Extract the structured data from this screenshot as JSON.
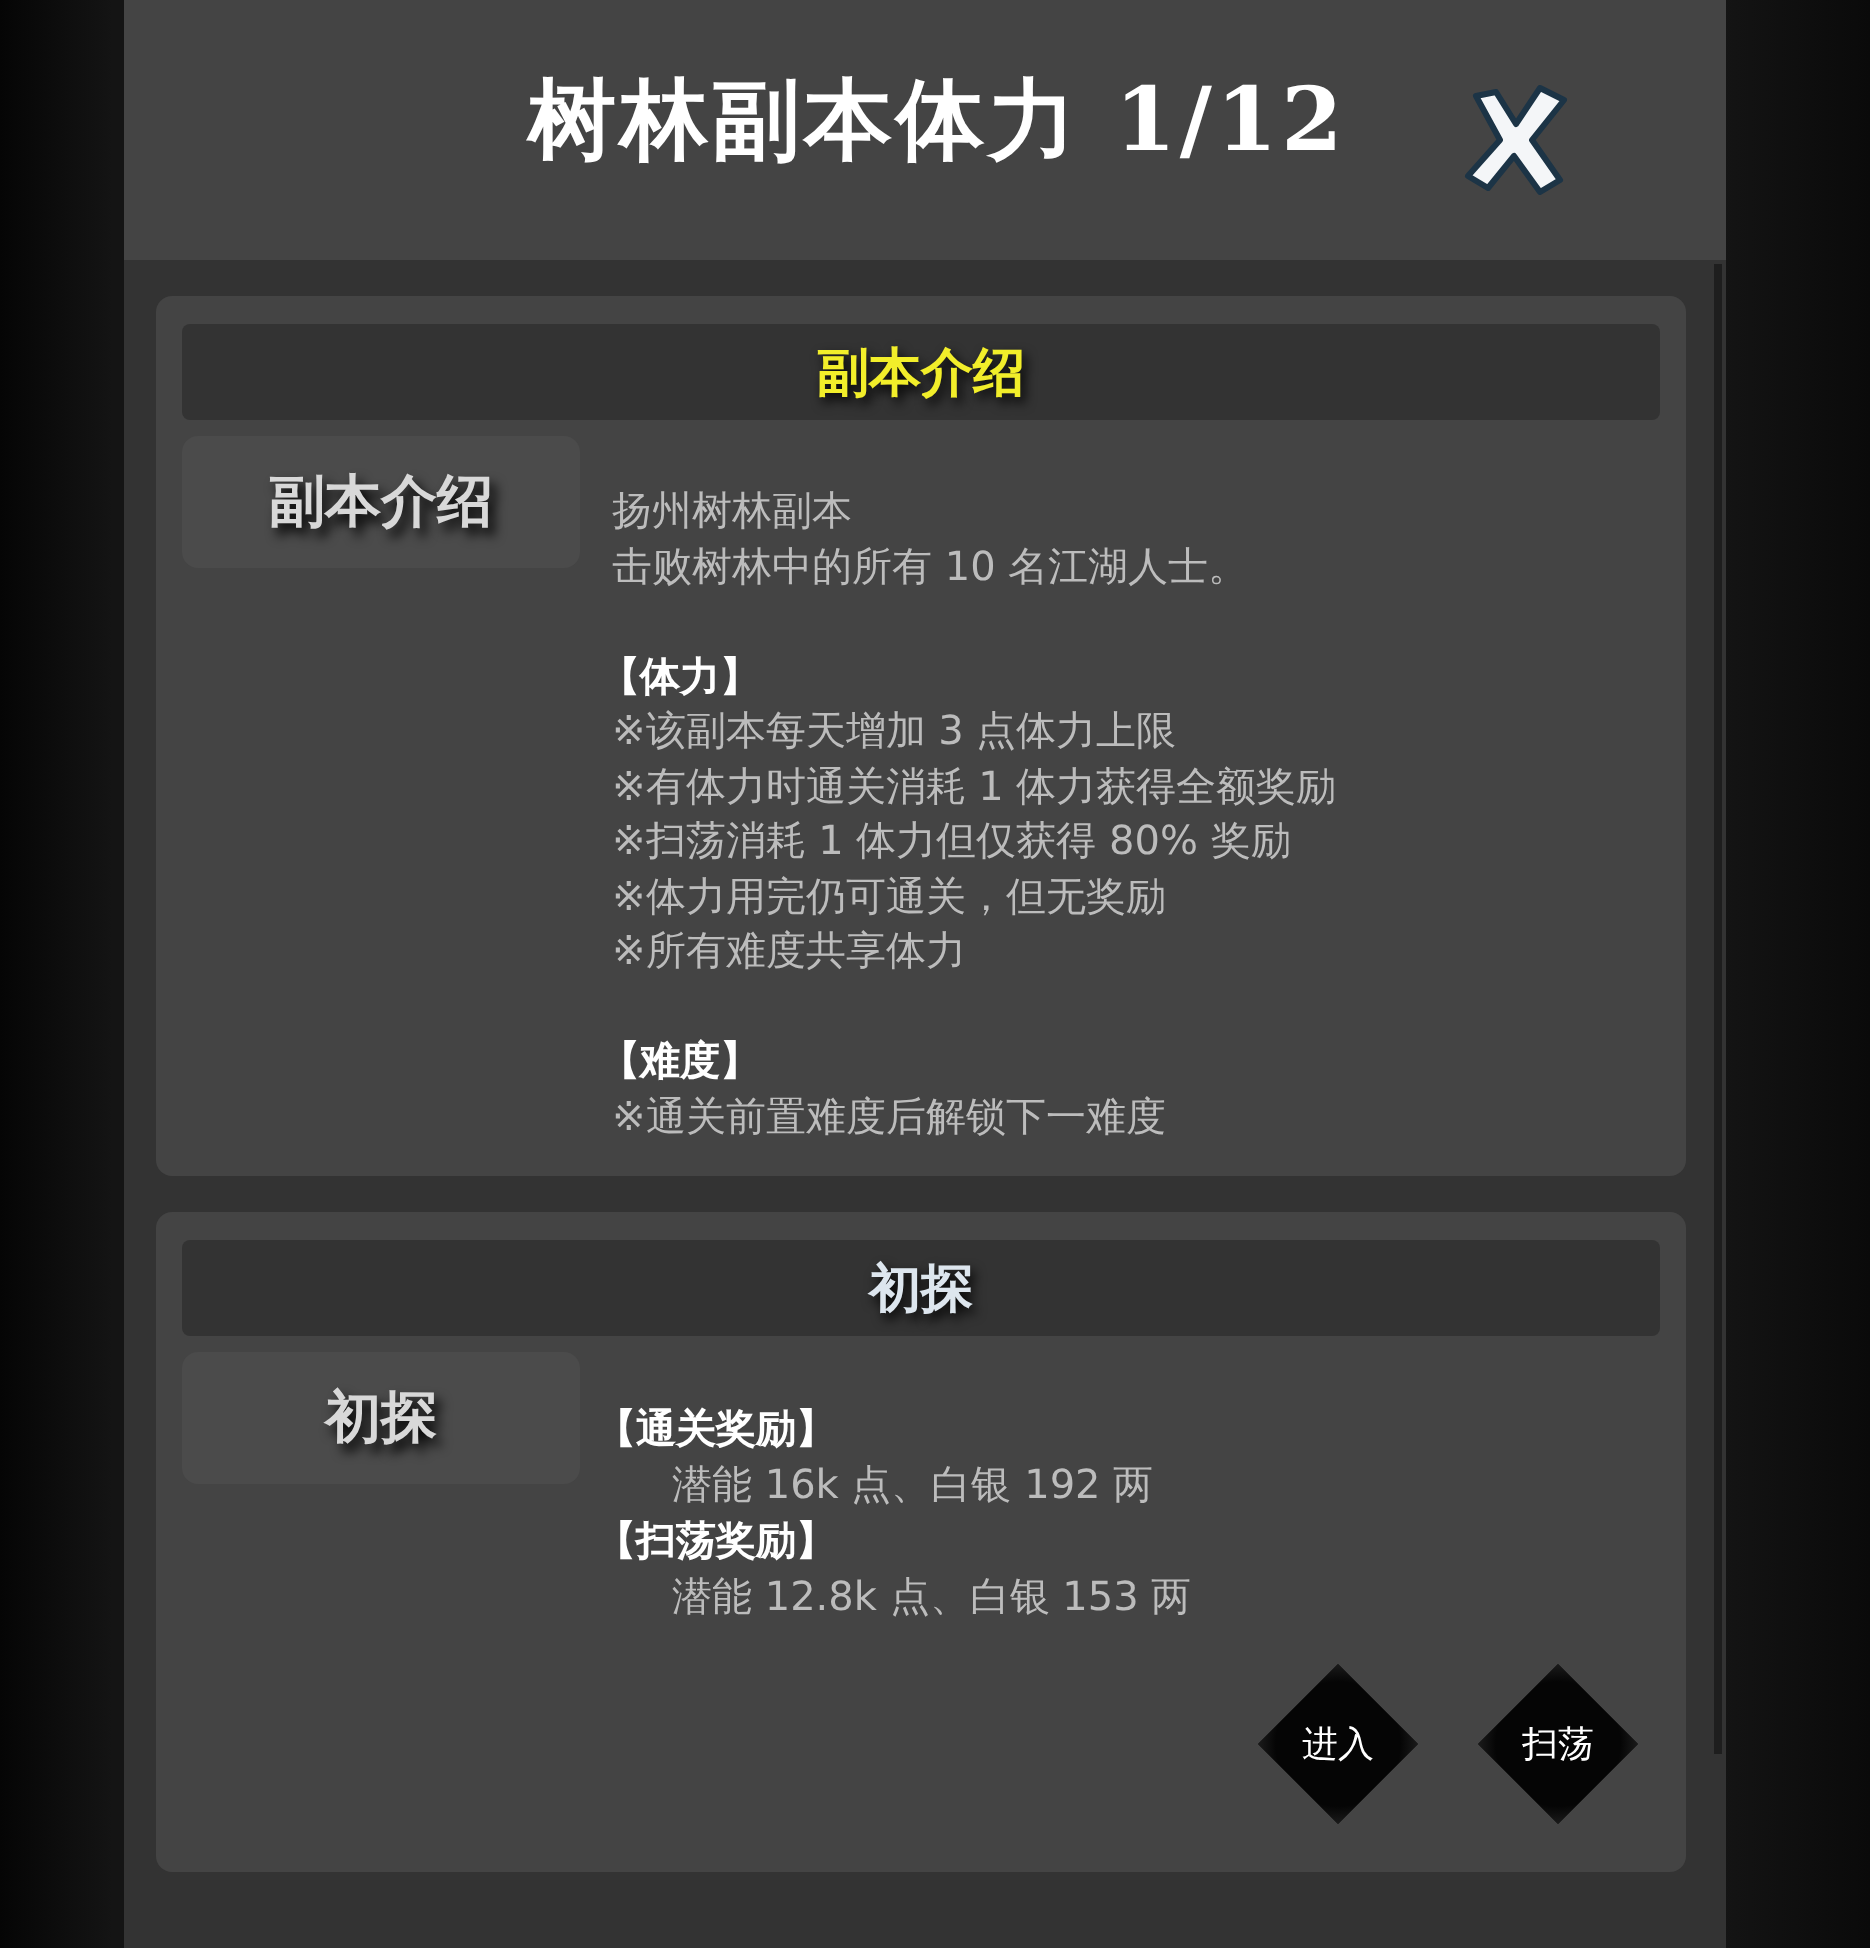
{
  "header": {
    "title": "树林副本体力 1/12"
  },
  "sections": [
    {
      "title": "副本介绍",
      "color": "#f2ee2a",
      "side_label": "副本介绍",
      "kind": "intro",
      "lines": [
        {
          "kind": "text",
          "text": "扬州树林副本"
        },
        {
          "kind": "text",
          "text": "击败树林中的所有 10 名江湖人士。"
        },
        {
          "kind": "gap"
        },
        {
          "kind": "heading",
          "text": "【体力】"
        },
        {
          "kind": "text",
          "text": "※该副本每天增加 3 点体力上限"
        },
        {
          "kind": "text",
          "text": "※有体力时通关消耗 1 体力获得全额奖励"
        },
        {
          "kind": "text",
          "text": "※扫荡消耗 1 体力但仅获得 80% 奖励"
        },
        {
          "kind": "text",
          "text": "※体力用完仍可通关，但无奖励"
        },
        {
          "kind": "text",
          "text": "※所有难度共享体力"
        },
        {
          "kind": "gap"
        },
        {
          "kind": "heading",
          "text": "【难度】"
        },
        {
          "kind": "text",
          "text": "※通关前置难度后解锁下一难度"
        }
      ]
    },
    {
      "title": "初探",
      "color": "#dde6ee",
      "side_label": "初探",
      "kind": "stage",
      "lines": [
        {
          "kind": "heading",
          "text": "【通关奖励】"
        },
        {
          "kind": "indent",
          "text": "潜能 16k 点、白银 192 两"
        },
        {
          "kind": "heading",
          "text": "【扫荡奖励】"
        },
        {
          "kind": "indent",
          "text": "潜能 12.8k 点、白银 153 两"
        }
      ],
      "buttons": [
        "进入",
        "扫荡"
      ]
    }
  ]
}
